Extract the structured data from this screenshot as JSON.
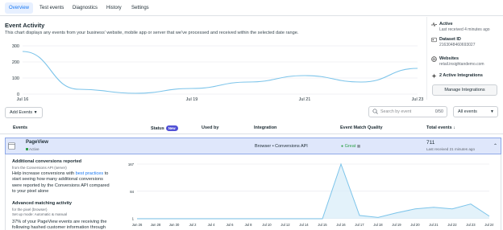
{
  "tabs": [
    "Overview",
    "Test events",
    "Diagnostics",
    "History",
    "Settings"
  ],
  "event_activity": {
    "title": "Event Activity",
    "description": "This chart displays any events from your business' website, mobile app or server that we've processed and received within the selected date range."
  },
  "side": {
    "status_title": "Active",
    "status_sub": "Last received 4 minutes ago",
    "dataset_title": "Dataset ID",
    "dataset_id": "2163048460693027",
    "websites_title": "Websites",
    "website": "retail.insightandemo.com",
    "integrations": "2 Active Integrations",
    "manage_button": "Manage Integrations",
    "icons": [
      "pulse-icon",
      "id-icon",
      "globe-icon",
      "integrations-icon"
    ]
  },
  "toolbar": {
    "add_events": "Add Events",
    "search_placeholder": "Search by event",
    "search_count": "0/50",
    "filter": "All events"
  },
  "table": {
    "headers": {
      "events": "Events",
      "status": "Status",
      "new_badge": "New",
      "used_by": "Used by",
      "integration": "Integration",
      "emq": "Event Match Quality",
      "total": "Total events ↓"
    },
    "row": {
      "name": "PageView",
      "status": "Active",
      "integration": "Browser • Conversions API",
      "emq": "Great",
      "total": "711",
      "total_sub": "Last received 21 minutes ago"
    }
  },
  "detail": {
    "acr_title": "Additional conversions reported",
    "acr_sub": "from the Conversions API (server)",
    "acr_text_1": "Help increase conversions with",
    "acr_link": "best practices",
    "acr_text_2": "to start seeing how many additional conversions were reported by the Conversions API compared to your pixel alone",
    "amm_title": "Advanced matching activity",
    "amm_sub1": "for the pixel (browser)",
    "amm_sub2": "Set up mode: Automatic & manual",
    "amm_text": "37% of your PageView events are receiving the",
    "amm_text_cut": "following hashed customer information through"
  },
  "colors": {
    "accent": "#1877f2",
    "line": "#7cc4ea",
    "selected_row": "#dfe7fb",
    "great": "#31a24c"
  },
  "chart_data": [
    {
      "type": "line",
      "x": [
        "Jul 16",
        "Jul 17",
        "Jul 18",
        "Jul 19",
        "Jul 20",
        "Jul 21",
        "Jul 22",
        "Jul 23"
      ],
      "values": [
        265,
        30,
        5,
        35,
        75,
        115,
        75,
        160
      ],
      "xticks": [
        "Jul 16",
        "Jul 19",
        "Jul 21",
        "Jul 23"
      ],
      "yticks": [
        0,
        100,
        200,
        300
      ],
      "ylim": [
        0,
        300
      ],
      "grid": true
    },
    {
      "type": "line",
      "x": [
        "Jun 26",
        "Jun 28",
        "Jun 30",
        "Jul 2",
        "Jul 4",
        "Jul 6",
        "Jul 8",
        "Jul 10",
        "Jul 12",
        "Jul 14",
        "Jul 15",
        "Jul 16",
        "Jul 17",
        "Jul 18",
        "Jul 19",
        "Jul 20",
        "Jul 21",
        "Jul 22",
        "Jul 23",
        "Jul 24"
      ],
      "values": [
        0,
        0,
        0,
        0,
        0,
        0,
        0,
        0,
        0,
        0,
        0,
        167,
        10,
        4,
        18,
        30,
        35,
        30,
        45,
        8
      ],
      "xticks": [
        "Jun 26",
        "Jun 28",
        "Jun 30",
        "Jul 2",
        "Jul 4",
        "Jul 6",
        "Jul 8",
        "Jul 10",
        "Jul 12",
        "Jul 14",
        "Jul 15",
        "Jul 16",
        "Jul 17",
        "Jul 18",
        "Jul 19",
        "Jul 20",
        "Jul 21",
        "Jul 22",
        "Jul 23",
        "Jul 24"
      ],
      "yticks": [
        1,
        84,
        167
      ],
      "ylim": [
        0,
        167
      ],
      "grid": true
    }
  ]
}
